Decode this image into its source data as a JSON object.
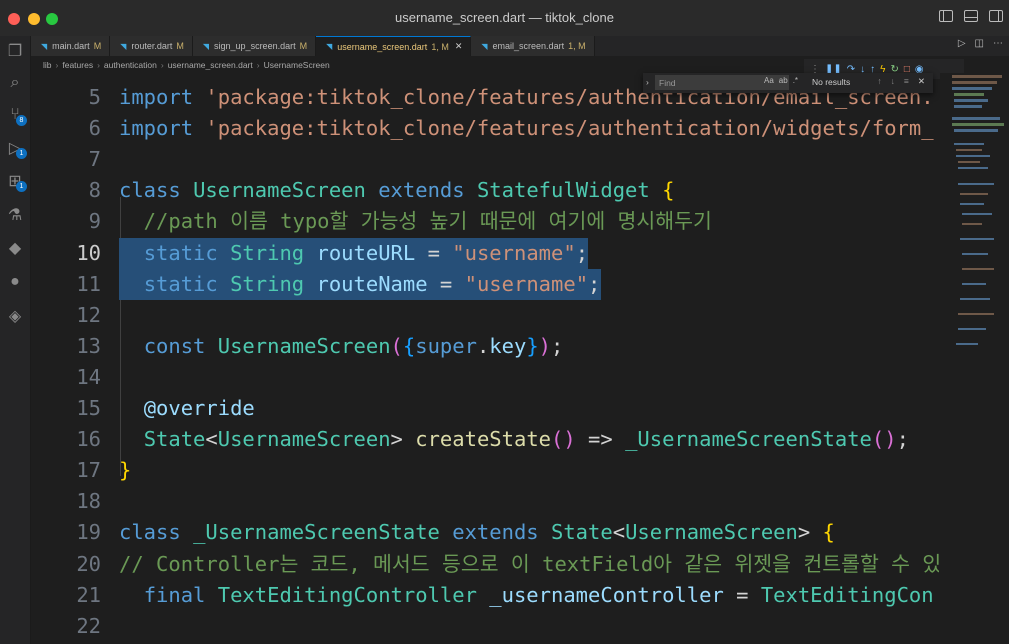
{
  "window": {
    "title": "username_screen.dart — tiktok_clone"
  },
  "activity_bar": [
    {
      "name": "explorer",
      "glyph": "❐",
      "badge": ""
    },
    {
      "name": "search",
      "glyph": "⌕",
      "badge": ""
    },
    {
      "name": "source-control",
      "glyph": "⑂",
      "badge": "8"
    },
    {
      "name": "run-debug",
      "glyph": "▷",
      "badge": "1"
    },
    {
      "name": "extensions",
      "glyph": "⊞",
      "badge": "1"
    },
    {
      "name": "testing",
      "glyph": "⚗",
      "badge": ""
    },
    {
      "name": "flutter",
      "glyph": "◆",
      "badge": ""
    },
    {
      "name": "github",
      "glyph": "●",
      "badge": ""
    },
    {
      "name": "remote",
      "glyph": "◈",
      "badge": ""
    }
  ],
  "tabs": [
    {
      "label": "main.dart",
      "status": "M",
      "active": false
    },
    {
      "label": "router.dart",
      "status": "M",
      "active": false
    },
    {
      "label": "sign_up_screen.dart",
      "status": "M",
      "active": false
    },
    {
      "label": "username_screen.dart",
      "status": "1, M",
      "active": true
    },
    {
      "label": "email_screen.dart",
      "status": "1, M",
      "active": false
    }
  ],
  "breadcrumb": [
    "lib",
    "features",
    "authentication",
    "username_screen.dart",
    "UsernameScreen"
  ],
  "find_widget": {
    "placeholder": "Find",
    "opts": [
      "Aa",
      "ab",
      ".*"
    ],
    "result": "No results"
  },
  "editor": {
    "current_line": 10,
    "lines": [
      {
        "n": "5",
        "tokens": [
          {
            "c": "k",
            "t": "import"
          },
          {
            "c": "p",
            "t": " "
          },
          {
            "c": "s",
            "t": "'package:tiktok_clone/features/authentication/email_screen."
          }
        ]
      },
      {
        "n": "6",
        "tokens": [
          {
            "c": "k",
            "t": "import"
          },
          {
            "c": "p",
            "t": " "
          },
          {
            "c": "s",
            "t": "'package:tiktok_clone/features/authentication/widgets/form_"
          }
        ]
      },
      {
        "n": "7",
        "tokens": []
      },
      {
        "n": "8",
        "tokens": [
          {
            "c": "k",
            "t": "class"
          },
          {
            "c": "p",
            "t": " "
          },
          {
            "c": "t",
            "t": "UsernameScreen"
          },
          {
            "c": "p",
            "t": " "
          },
          {
            "c": "k",
            "t": "extends"
          },
          {
            "c": "p",
            "t": " "
          },
          {
            "c": "t",
            "t": "StatefulWidget"
          },
          {
            "c": "p",
            "t": " "
          },
          {
            "c": "y",
            "t": "{"
          }
        ]
      },
      {
        "n": "9",
        "tokens": [
          {
            "c": "c",
            "t": "  //path 이름 typo할 가능성 높기 때문에 여기에 명시해두기"
          }
        ]
      },
      {
        "n": "10",
        "sel": true,
        "tokens": [
          {
            "c": "p",
            "t": "  "
          },
          {
            "c": "k",
            "t": "static"
          },
          {
            "c": "p",
            "t": " "
          },
          {
            "c": "t",
            "t": "String"
          },
          {
            "c": "p",
            "t": " "
          },
          {
            "c": "v",
            "t": "routeURL"
          },
          {
            "c": "p",
            "t": " = "
          },
          {
            "c": "s",
            "t": "\"username\""
          },
          {
            "c": "p",
            "t": ";"
          }
        ]
      },
      {
        "n": "11",
        "sel": true,
        "tokens": [
          {
            "c": "p",
            "t": "  "
          },
          {
            "c": "k",
            "t": "static"
          },
          {
            "c": "p",
            "t": " "
          },
          {
            "c": "t",
            "t": "String"
          },
          {
            "c": "p",
            "t": " "
          },
          {
            "c": "v",
            "t": "routeName"
          },
          {
            "c": "p",
            "t": " = "
          },
          {
            "c": "s",
            "t": "\"username\""
          },
          {
            "c": "p",
            "t": ";"
          }
        ]
      },
      {
        "n": "12",
        "tokens": []
      },
      {
        "n": "13",
        "tokens": [
          {
            "c": "p",
            "t": "  "
          },
          {
            "c": "k",
            "t": "const"
          },
          {
            "c": "p",
            "t": " "
          },
          {
            "c": "t",
            "t": "UsernameScreen"
          },
          {
            "c": "m",
            "t": "("
          },
          {
            "c": "b",
            "t": "{"
          },
          {
            "c": "k",
            "t": "super"
          },
          {
            "c": "p",
            "t": "."
          },
          {
            "c": "v",
            "t": "key"
          },
          {
            "c": "b",
            "t": "}"
          },
          {
            "c": "m",
            "t": ")"
          },
          {
            "c": "p",
            "t": ";"
          }
        ]
      },
      {
        "n": "14",
        "tokens": []
      },
      {
        "n": "15",
        "tokens": [
          {
            "c": "p",
            "t": "  "
          },
          {
            "c": "v",
            "t": "@override"
          }
        ]
      },
      {
        "n": "16",
        "tokens": [
          {
            "c": "p",
            "t": "  "
          },
          {
            "c": "t",
            "t": "State"
          },
          {
            "c": "p",
            "t": "<"
          },
          {
            "c": "t",
            "t": "UsernameScreen"
          },
          {
            "c": "p",
            "t": "> "
          },
          {
            "c": "f",
            "t": "createState"
          },
          {
            "c": "m",
            "t": "()"
          },
          {
            "c": "p",
            "t": " => "
          },
          {
            "c": "t",
            "t": "_UsernameScreenState"
          },
          {
            "c": "m",
            "t": "()"
          },
          {
            "c": "p",
            "t": ";"
          }
        ]
      },
      {
        "n": "17",
        "tokens": [
          {
            "c": "y",
            "t": "}"
          }
        ]
      },
      {
        "n": "18",
        "tokens": []
      },
      {
        "n": "19",
        "tokens": [
          {
            "c": "k",
            "t": "class"
          },
          {
            "c": "p",
            "t": " "
          },
          {
            "c": "t",
            "t": "_UsernameScreenState"
          },
          {
            "c": "p",
            "t": " "
          },
          {
            "c": "k",
            "t": "extends"
          },
          {
            "c": "p",
            "t": " "
          },
          {
            "c": "t",
            "t": "State"
          },
          {
            "c": "p",
            "t": "<"
          },
          {
            "c": "t",
            "t": "UsernameScreen"
          },
          {
            "c": "p",
            "t": "> "
          },
          {
            "c": "y",
            "t": "{"
          }
        ]
      },
      {
        "n": "20",
        "tokens": [
          {
            "c": "c",
            "t": "// Controller는 코드, 메서드 등으로 이 textField아 같은 위젯을 컨트롤할 수 있게"
          }
        ]
      },
      {
        "n": "21",
        "tokens": [
          {
            "c": "p",
            "t": "  "
          },
          {
            "c": "k",
            "t": "final"
          },
          {
            "c": "p",
            "t": " "
          },
          {
            "c": "t",
            "t": "TextEditingController"
          },
          {
            "c": "p",
            "t": " "
          },
          {
            "c": "v",
            "t": "_usernameController"
          },
          {
            "c": "p",
            "t": " = "
          },
          {
            "c": "t",
            "t": "TextEditingCon"
          }
        ]
      },
      {
        "n": "22",
        "tokens": []
      }
    ]
  }
}
